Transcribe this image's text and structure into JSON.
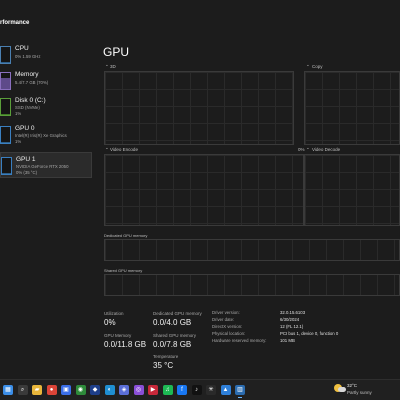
{
  "window": {
    "title": "rformance"
  },
  "sidebar": {
    "items": [
      {
        "name": "CPU",
        "sub1": "0% 1.59 GHz",
        "sub2": "",
        "level": 0.05,
        "kind": "cpu"
      },
      {
        "name": "Memory",
        "sub1": "5.4/7.7 GB (70%)",
        "sub2": "",
        "level": 0.7,
        "kind": "mem"
      },
      {
        "name": "Disk 0 (C:)",
        "sub1": "SSD (NVMe)",
        "sub2": "1%",
        "level": 0.02,
        "kind": "disk"
      },
      {
        "name": "GPU 0",
        "sub1": "Intel(R) Iris(R) Xe Graphics",
        "sub2": "1%",
        "level": 0.02,
        "kind": "gpu"
      },
      {
        "name": "GPU 1",
        "sub1": "NVIDIA GeForce RTX 2050",
        "sub2": "0% (35 °C)",
        "level": 0.0,
        "kind": "gpu"
      }
    ]
  },
  "main": {
    "title": "GPU",
    "graphs": {
      "top_left": {
        "label": "3D",
        "pct": ""
      },
      "top_right": {
        "label": "Copy",
        "pct": ""
      },
      "bottom_left": {
        "label": "Video Encode",
        "pct": "0%"
      },
      "bottom_right": {
        "label": "Video Decode",
        "pct": ""
      }
    },
    "dedicated_label": "Dedicated GPU memory",
    "shared_label": "Shared GPU memory"
  },
  "stats": {
    "utilization": {
      "label": "Utilization",
      "value": "0%"
    },
    "dedicated": {
      "label": "Dedicated GPU memory",
      "value": "0.0/4.0 GB"
    },
    "gpu_memory": {
      "label": "GPU Memory",
      "value": "0.0/11.8 GB"
    },
    "shared": {
      "label": "Shared GPU memory",
      "value": "0.0/7.8 GB"
    },
    "temperature": {
      "label": "Temperature",
      "value": "35 °C"
    }
  },
  "details": [
    {
      "key": "Driver version:",
      "value": "32.0.15.6103"
    },
    {
      "key": "Driver date:",
      "value": "6/30/2024"
    },
    {
      "key": "DirectX version:",
      "value": "12 (FL 12.1)"
    },
    {
      "key": "Physical location:",
      "value": "PCI bus 1, device 0, function 0"
    },
    {
      "key": "Hardware reserved memory:",
      "value": "101 MB"
    }
  ],
  "taskbar": {
    "icons": [
      {
        "name": "start-icon",
        "glyph": "▦",
        "color": "#3b8ee8"
      },
      {
        "name": "search-icon",
        "glyph": "⌕",
        "color": "#3a3a3a"
      },
      {
        "name": "file-explorer-icon",
        "glyph": "▰",
        "color": "#e8b63b"
      },
      {
        "name": "chrome-icon",
        "glyph": "●",
        "color": "#db4437"
      },
      {
        "name": "store-icon",
        "glyph": "▣",
        "color": "#3b6fe8"
      },
      {
        "name": "xbox-icon",
        "glyph": "◉",
        "color": "#2e8b3a"
      },
      {
        "name": "app-icon",
        "glyph": "◆",
        "color": "#1e3f8a"
      },
      {
        "name": "edge-icon",
        "glyph": "◐",
        "color": "#1f8fd1"
      },
      {
        "name": "copilot-icon",
        "glyph": "◈",
        "color": "#5b6fd8"
      },
      {
        "name": "messenger-icon",
        "glyph": "◎",
        "color": "#8a4fd8"
      },
      {
        "name": "media-icon",
        "glyph": "▶",
        "color": "#c8283a"
      },
      {
        "name": "spotify-icon",
        "glyph": "♫",
        "color": "#1db954"
      },
      {
        "name": "facebook-icon",
        "glyph": "f",
        "color": "#1877f2"
      },
      {
        "name": "tiktok-icon",
        "glyph": "♪",
        "color": "#111111"
      },
      {
        "name": "chatgpt-icon",
        "glyph": "✳",
        "color": "#2a2a2a"
      },
      {
        "name": "photos-icon",
        "glyph": "▲",
        "color": "#2e7fd8"
      },
      {
        "name": "task-manager-icon",
        "glyph": "▥",
        "color": "#2b6cb0"
      }
    ],
    "weather": {
      "temp": "32°C",
      "condition": "Partly sunny"
    }
  }
}
